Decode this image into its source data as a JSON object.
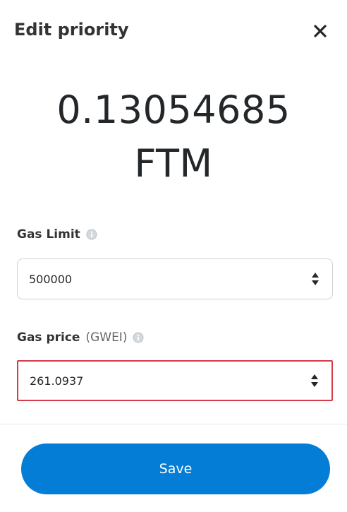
{
  "header": {
    "title": "Edit priority",
    "close_icon": "close-icon"
  },
  "amount": {
    "value": "0.13054685",
    "unit": "FTM"
  },
  "gas_limit": {
    "label": "Gas Limit",
    "value": "500000",
    "info_icon": "info-icon"
  },
  "gas_price": {
    "label": "Gas price",
    "unit_label": "(GWEI)",
    "value": "261.0937",
    "info_icon": "info-icon",
    "error_color": "#d73a49"
  },
  "footer": {
    "save_label": "Save",
    "button_color": "#037dd6"
  }
}
